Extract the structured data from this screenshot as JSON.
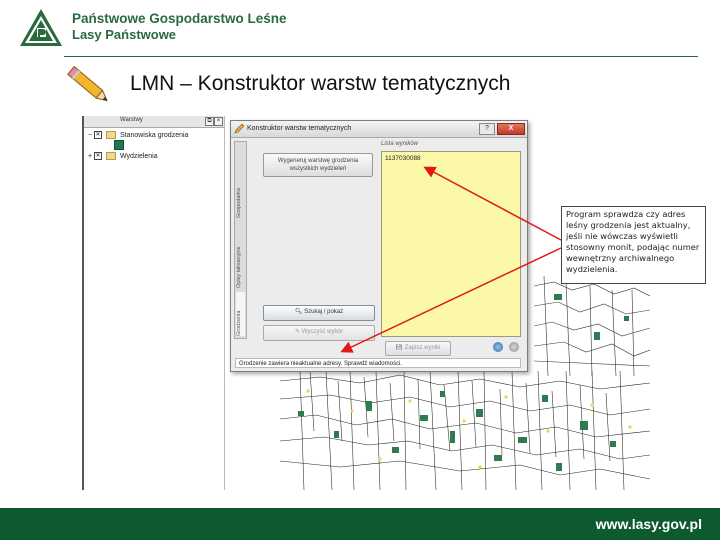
{
  "header": {
    "org_line1": "Państwowe Gospodarstwo Leśne",
    "org_line2": "Lasy Państwowe",
    "logo_text": "LASY PAŃSTWOWE"
  },
  "slide": {
    "title": "LMN – Konstruktor warstw tematycznych"
  },
  "layers_panel": {
    "title": "Warstwy",
    "items": [
      {
        "label": "Stanowiska grodzenia"
      },
      {
        "label": "Wydzielenia"
      }
    ]
  },
  "dialog": {
    "title": "Konstruktor warstw tematycznych",
    "help_label": "?",
    "close_label": "X",
    "tabs": [
      {
        "label": "Grodzenia"
      },
      {
        "label": "Opisy taksacyjne"
      },
      {
        "label": "Gospodarka"
      }
    ],
    "generate_button_label": "Wygeneruj warstwę grodzenia wszystkich wydzieleń",
    "search_button_label": "Szukaj / pokaż",
    "clear_button_label": "Wyczyść wybór",
    "list_label": "Lista wyników",
    "list_items": [
      "1137030088"
    ],
    "save_button_label": "Zapisz wyniki",
    "status_text": "Grodzenie zawiera nieaktualne adresy. Sprawdź wiadomości."
  },
  "callout": {
    "text": "Program sprawdza czy adres leśny grodzenia jest aktualny, jeśli nie wówczas wyświetli stosowny monit, podając numer wewnętrzny archiwalnego wydzielenia."
  },
  "footer": {
    "url": "www.lasy.gov.pl"
  },
  "colors": {
    "brand_green": "#2a6a3c",
    "footer_green": "#0e5a2f",
    "list_background": "#fbf9a8",
    "arrow_red": "#e01818"
  }
}
